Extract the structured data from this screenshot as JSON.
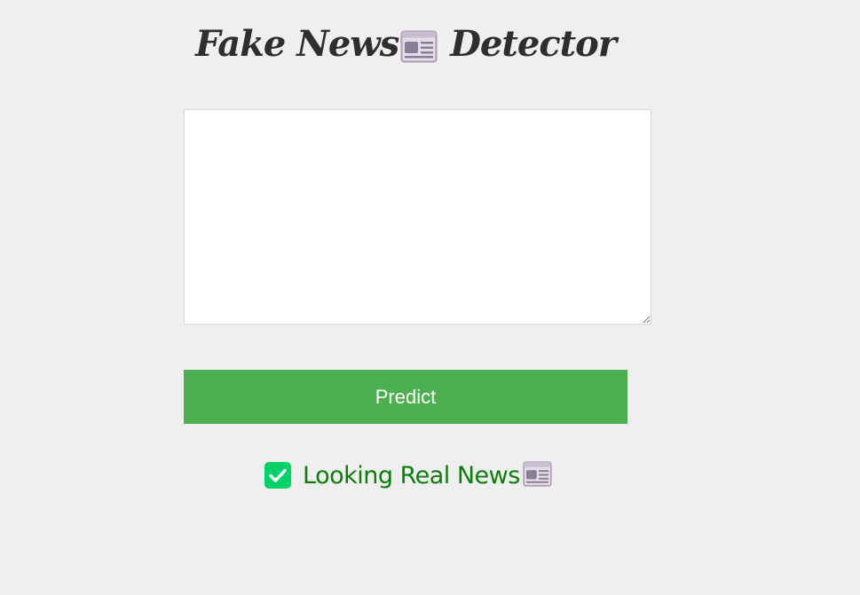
{
  "header": {
    "title_part1": "Fake News",
    "title_icon": "newspaper-icon",
    "title_part2": "Detector"
  },
  "input": {
    "value": "",
    "placeholder": ""
  },
  "predict_button": {
    "label": "Predict",
    "color": "#4caf50"
  },
  "result": {
    "status_icon": "check-mark-icon",
    "status_color": "#00d26a",
    "text": "Looking Real News",
    "text_color": "#0a7d0a",
    "trailing_icon": "newspaper-icon"
  }
}
